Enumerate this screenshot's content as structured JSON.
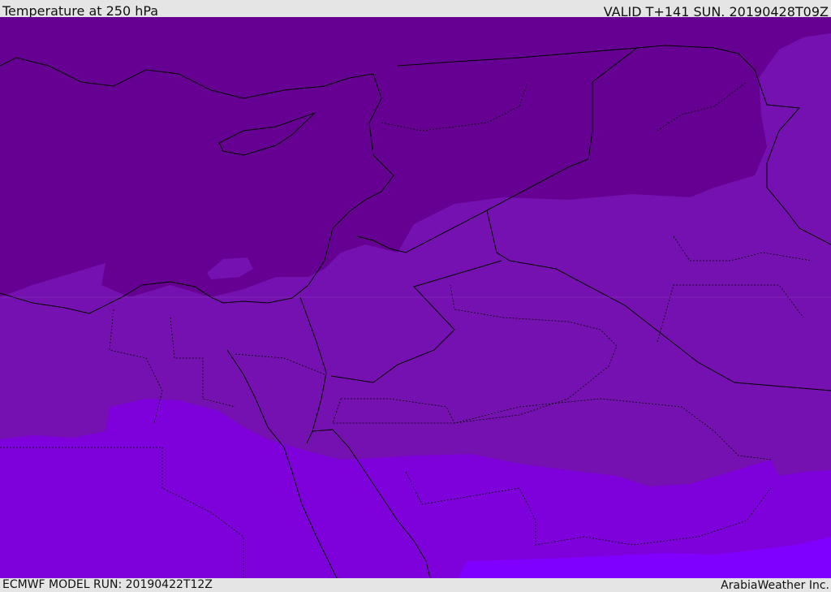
{
  "header": {
    "title": "Temperature at 250 hPa",
    "valid": "VALID T+141 SUN. 20190428T09Z"
  },
  "footer": {
    "model_run": "ECMWF MODEL RUN: 20190422T12Z",
    "credit": "ArabiaWeather Inc."
  },
  "colors": {
    "band_coldest": "#660092",
    "band_cold": "#7511b0",
    "band_mid": "#7e00da",
    "band_warm": "#8000ff",
    "frame": "#e5e5e5"
  }
}
